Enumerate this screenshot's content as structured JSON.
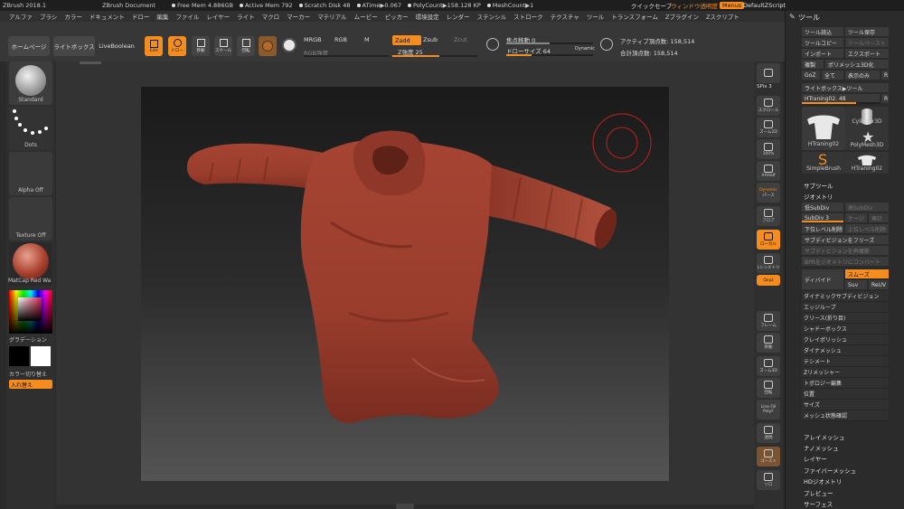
{
  "titlebar": {
    "app": "ZBrush 2018.1",
    "doc": "ZBrush Document",
    "free_mem": "Free Mem 4.886GB",
    "active_mem": "Active Mem 792",
    "scratch": "Scratch Disk 48",
    "atime": "ATime▶0.067",
    "polycount": "PolyCount▶158.128 KP",
    "meshcount": "MeshCount▶1",
    "quicksave": "クイックセーブ",
    "transparency": "ウィンドウ透明度",
    "menus": "Menus",
    "script": "DefaultZScript"
  },
  "menubar": [
    "アルファ",
    "ブラシ",
    "カラー",
    "ドキュメント",
    "ドロー",
    "編集",
    "ファイル",
    "レイヤー",
    "ライト",
    "マクロ",
    "マーカー",
    "マテリアル",
    "ムービー",
    "ピッカー",
    "環境設定",
    "レンダー",
    "ステンシル",
    "ストローク",
    "テクスチャ",
    "ツール",
    "トランスフォーム",
    "Zプラグイン",
    "Zスクリプト"
  ],
  "toolbar": {
    "home": "ホームページ",
    "lightbox": "ライトボックス",
    "liveboolean": "LiveBoolean",
    "edit": "Edit",
    "draw": "ドロー",
    "move": "移動",
    "scale": "スケール",
    "rotate": "回転",
    "mrgb": "MRGB",
    "rgb": "RGB",
    "m": "M",
    "rgb_intensity": "RGB強度",
    "zadd": "Zadd",
    "zsub": "Zsub",
    "zcut": "Zcut",
    "z_intensity": "Z強度 25",
    "focal_shift": "焦点移動 0",
    "draw_size": "ドローサイズ 64",
    "dynamic": "Dynamic",
    "active_points": "アクティブ頂点数: 158,514",
    "total_points": "合計頂点数: 158,514"
  },
  "leftshelf": {
    "brush": "Standard",
    "stroke": "Dots",
    "alpha": "Alpha Off",
    "texture": "Texture Off",
    "material": "MatCap Red Wa",
    "gradient": "グラデーション",
    "switch_color": "カラー切り替え",
    "swap": "入れ替え"
  },
  "rightshelf": [
    "SPix 3",
    "スクロール",
    "ズーム2D",
    "100%",
    "AAHalf",
    "Dynamic",
    "パース",
    "フロア",
    "ローカル",
    "Lシンメトリ",
    "Qxyz",
    "フレーム",
    "移動",
    "ズーム3D",
    "回転",
    "Line Fill",
    "PolyF",
    "透明",
    "ゴースト",
    "ソロ"
  ],
  "palette": {
    "title": "ツール",
    "load": "ツール読込",
    "save": "ツール保存",
    "copy": "ツールコピー",
    "paste": "ツールペースト",
    "import": "インポート",
    "export": "エクスポート",
    "clone": "複製",
    "polymesh3d": "ポリメッシュ3D化",
    "goz": "GoZ",
    "all": "全て",
    "visible": "表示のみ",
    "r": "R",
    "lightbox_tool": "ライトボックス▶ツール",
    "current_tool": "HTraning02. 48",
    "tools": [
      "HTraning02",
      "Cylinder3D",
      "PolyMesh3D",
      "SimpleBrush",
      "HTraning02"
    ],
    "subtool": "サブツール",
    "geometry": "ジオメトリ",
    "lower_res": "低SubDiv",
    "higher_res": "高SubDiv",
    "subdiv": "SubDiv 3",
    "cage": "ケージ",
    "rstr": "再計",
    "del_lower": "下位レベル削除",
    "del_higher": "上位レベル削除",
    "freeze_subdiv": "サブディビジョンをフリーズ",
    "reconstruct": "サブディビジョンを再構築",
    "convert_bpr": "BPRをジオメトリにコンバート",
    "divide": "ディバイド",
    "smooth": "スムーズ",
    "suv": "Suv",
    "reuv": "ReUV",
    "geom_items": [
      "ダイナミックサブディビジョン",
      "エッジループ",
      "クリース(折り目)",
      "シャドーボックス",
      "クレイポリッシュ",
      "ダイナメッシュ",
      "テシメート",
      "Zリメッシャー",
      "トポロジー編集",
      "位置",
      "サイズ",
      "メッシュ状態確認"
    ],
    "sections": [
      "アレイメッシュ",
      "ナノメッシュ",
      "レイヤー",
      "ファイバーメッシュ",
      "HDジオメトリ",
      "プレビュー",
      "サーフェス"
    ]
  },
  "colors": {
    "accent": "#f48c1e",
    "model": "#9c3c2e",
    "canvas_top": "#1a1a1a",
    "canvas_bottom": "#545454"
  }
}
